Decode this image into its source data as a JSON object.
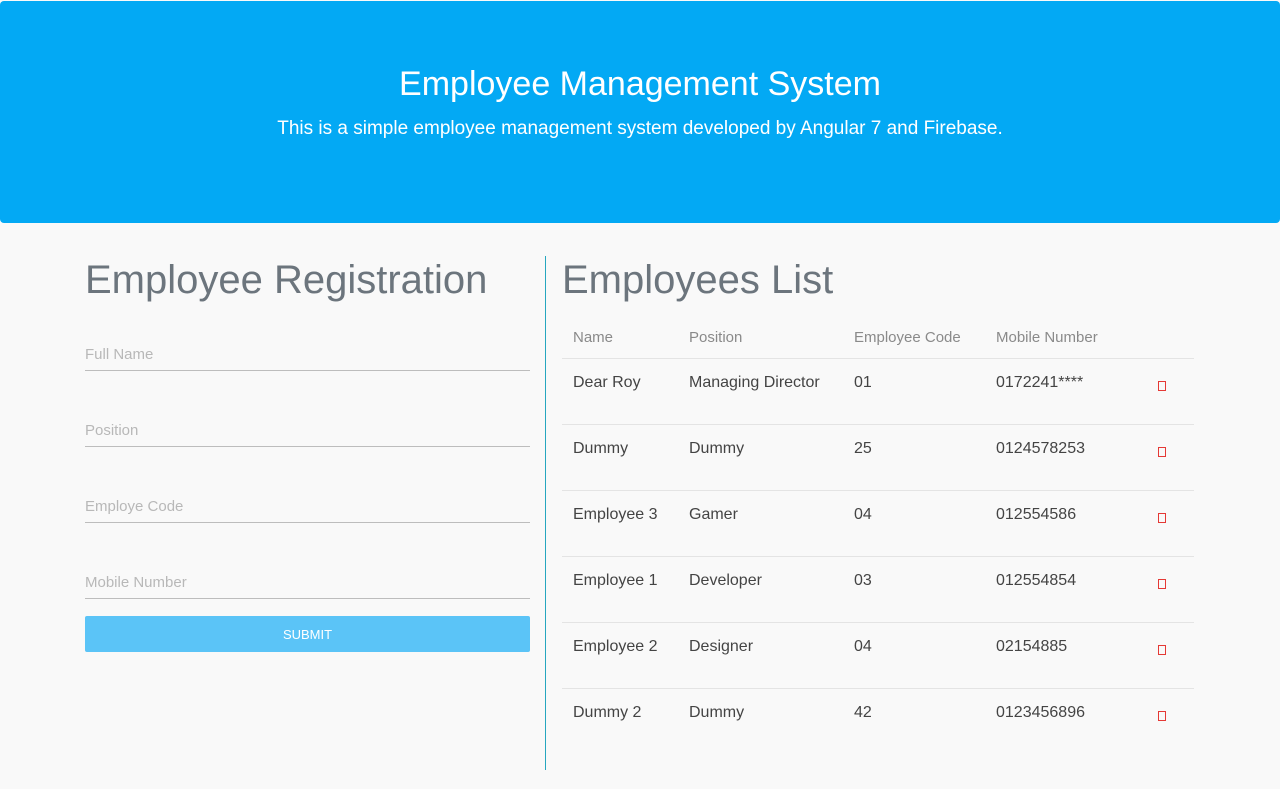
{
  "header": {
    "title": "Employee Management System",
    "subtitle": "This is a simple employee management system developed by Angular 7 and Firebase."
  },
  "registration": {
    "title": "Employee Registration",
    "fields": [
      {
        "name": "full-name",
        "placeholder": "Full Name",
        "value": ""
      },
      {
        "name": "position",
        "placeholder": "Position",
        "value": ""
      },
      {
        "name": "employee-code",
        "placeholder": "Employe Code",
        "value": ""
      },
      {
        "name": "mobile-number",
        "placeholder": "Mobile Number",
        "value": ""
      }
    ],
    "submit_label": "Submit"
  },
  "list": {
    "title": "Employees List",
    "columns": [
      "Name",
      "Position",
      "Employee Code",
      "Mobile Number"
    ],
    "rows": [
      {
        "name": "Dear Roy",
        "position": "Managing Director",
        "code": "01",
        "mobile": "0172241****"
      },
      {
        "name": "Dummy",
        "position": "Dummy",
        "code": "25",
        "mobile": "0124578253"
      },
      {
        "name": "Employee 3",
        "position": "Gamer",
        "code": "04",
        "mobile": "012554586"
      },
      {
        "name": "Employee 1",
        "position": "Developer",
        "code": "03",
        "mobile": "012554854"
      },
      {
        "name": "Employee 2",
        "position": "Designer",
        "code": "04",
        "mobile": "02154885"
      },
      {
        "name": "Dummy 2",
        "position": "Dummy",
        "code": "42",
        "mobile": "0123456896"
      }
    ],
    "row_action_icon": "delete-icon"
  },
  "colors": {
    "header_bg": "#03a9f4",
    "submit_bg": "#5bc4f7",
    "divider": "#26a7c0",
    "delete_icon": "#e53935"
  }
}
